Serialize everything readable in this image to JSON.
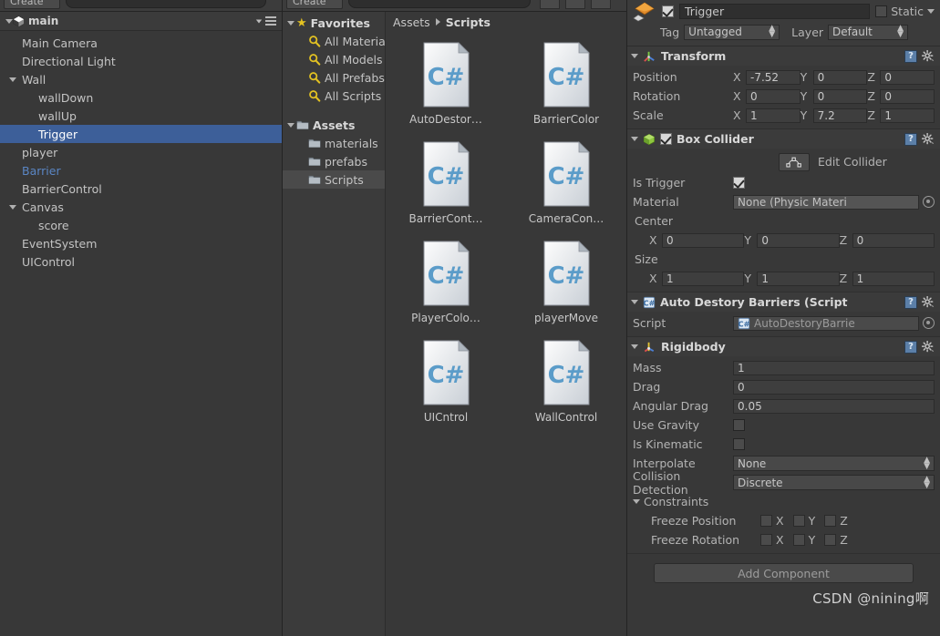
{
  "toolbars": {
    "create_label": "Create",
    "hierarchy_search_placeholder": "",
    "project_search_placeholder": ""
  },
  "hierarchy": {
    "scene_name": "main",
    "scene_icon": "unity-scene-icon",
    "menu_icon": "hamburger-menu-icon",
    "items": [
      {
        "label": "Main Camera",
        "depth": 1,
        "fold": "",
        "state": "normal"
      },
      {
        "label": "Directional Light",
        "depth": 1,
        "fold": "",
        "state": "normal"
      },
      {
        "label": "Wall",
        "depth": 1,
        "fold": "open",
        "state": "normal"
      },
      {
        "label": "wallDown",
        "depth": 2,
        "fold": "",
        "state": "normal"
      },
      {
        "label": "wallUp",
        "depth": 2,
        "fold": "",
        "state": "normal"
      },
      {
        "label": "Trigger",
        "depth": 2,
        "fold": "",
        "state": "selected"
      },
      {
        "label": "player",
        "depth": 1,
        "fold": "",
        "state": "normal"
      },
      {
        "label": "Barrier",
        "depth": 1,
        "fold": "",
        "state": "prefab"
      },
      {
        "label": "BarrierControl",
        "depth": 1,
        "fold": "",
        "state": "normal"
      },
      {
        "label": "Canvas",
        "depth": 1,
        "fold": "open",
        "state": "normal"
      },
      {
        "label": "score",
        "depth": 2,
        "fold": "",
        "state": "normal"
      },
      {
        "label": "EventSystem",
        "depth": 1,
        "fold": "",
        "state": "normal"
      },
      {
        "label": "UIControl",
        "depth": 1,
        "fold": "",
        "state": "normal"
      }
    ]
  },
  "project": {
    "tree": [
      {
        "label": "Favorites",
        "depth": 0,
        "fold": "open",
        "icon": "star-icon",
        "bold": true,
        "selected": false
      },
      {
        "label": "All Materials",
        "depth": 1,
        "fold": "",
        "icon": "search-icon",
        "bold": false,
        "selected": false
      },
      {
        "label": "All Models",
        "depth": 1,
        "fold": "",
        "icon": "search-icon",
        "bold": false,
        "selected": false
      },
      {
        "label": "All Prefabs",
        "depth": 1,
        "fold": "",
        "icon": "search-icon",
        "bold": false,
        "selected": false
      },
      {
        "label": "All Scripts",
        "depth": 1,
        "fold": "",
        "icon": "search-icon",
        "bold": false,
        "selected": false
      },
      {
        "label": "",
        "depth": 0,
        "fold": "",
        "icon": "",
        "bold": false,
        "selected": false
      },
      {
        "label": "Assets",
        "depth": 0,
        "fold": "open",
        "icon": "folder-icon",
        "bold": true,
        "selected": false
      },
      {
        "label": "materials",
        "depth": 1,
        "fold": "",
        "icon": "folder-icon",
        "bold": false,
        "selected": false
      },
      {
        "label": "prefabs",
        "depth": 1,
        "fold": "",
        "icon": "folder-icon",
        "bold": false,
        "selected": false
      },
      {
        "label": "Scripts",
        "depth": 1,
        "fold": "",
        "icon": "folder-icon",
        "bold": false,
        "selected": true
      }
    ],
    "breadcrumb": [
      "Assets",
      "Scripts"
    ],
    "assets": [
      {
        "label": "AutoDestor…",
        "icon": "csharp-script-icon"
      },
      {
        "label": "BarrierColor",
        "icon": "csharp-script-icon"
      },
      {
        "label": "BarrierCont…",
        "icon": "csharp-script-icon"
      },
      {
        "label": "CameraCon…",
        "icon": "csharp-script-icon"
      },
      {
        "label": "PlayerColo…",
        "icon": "csharp-script-icon"
      },
      {
        "label": "playerMove",
        "icon": "csharp-script-icon"
      },
      {
        "label": "UICntrol",
        "icon": "csharp-script-icon"
      },
      {
        "label": "WallControl",
        "icon": "csharp-script-icon"
      }
    ]
  },
  "inspector": {
    "gameobject": {
      "icon": "gameobject-cube-icon",
      "enabled": true,
      "name": "Trigger",
      "static_label": "Static",
      "static_checked": false,
      "tag_label": "Tag",
      "tag_value": "Untagged",
      "layer_label": "Layer",
      "layer_value": "Default"
    },
    "components": [
      {
        "name": "Transform",
        "icon": "transform-icon",
        "expanded": true,
        "has_enable_checkbox": false,
        "rows": [
          {
            "label": "Position",
            "type": "vector3",
            "x": "-7.52",
            "y": "0",
            "z": "0"
          },
          {
            "label": "Rotation",
            "type": "vector3",
            "x": "0",
            "y": "0",
            "z": "0"
          },
          {
            "label": "Scale",
            "type": "vector3",
            "x": "1",
            "y": "7.2",
            "z": "1"
          }
        ]
      },
      {
        "name": "Box Collider",
        "icon": "box-collider-icon",
        "expanded": true,
        "has_enable_checkbox": true,
        "enabled": true,
        "edit_collider_label": "Edit Collider",
        "rows": [
          {
            "label": "Is Trigger",
            "type": "checkbox",
            "value": true
          },
          {
            "label": "Material",
            "type": "object",
            "value": "None (Physic Materi"
          },
          {
            "label": "Center",
            "type": "vector3-stacked",
            "x": "0",
            "y": "0",
            "z": "0"
          },
          {
            "label": "Size",
            "type": "vector3-stacked",
            "x": "1",
            "y": "1",
            "z": "1"
          }
        ]
      },
      {
        "name": "Auto Destory Barriers (Script",
        "icon": "csharp-component-icon",
        "expanded": true,
        "has_enable_checkbox": false,
        "rows": [
          {
            "label": "Script",
            "type": "object-dim",
            "value": "AutoDestoryBarrie"
          }
        ]
      },
      {
        "name": "Rigidbody",
        "icon": "rigidbody-icon",
        "expanded": true,
        "has_enable_checkbox": false,
        "rows": [
          {
            "label": "Mass",
            "type": "text",
            "value": "1"
          },
          {
            "label": "Drag",
            "type": "text",
            "value": "0"
          },
          {
            "label": "Angular Drag",
            "type": "text",
            "value": "0.05"
          },
          {
            "label": "Use Gravity",
            "type": "checkbox",
            "value": false
          },
          {
            "label": "Is Kinematic",
            "type": "checkbox",
            "value": false
          },
          {
            "label": "Interpolate",
            "type": "dropdown",
            "value": "None"
          },
          {
            "label": "Collision Detection",
            "type": "dropdown",
            "value": "Discrete"
          }
        ],
        "constraints": {
          "label": "Constraints",
          "freeze_position_label": "Freeze Position",
          "freeze_rotation_label": "Freeze Rotation",
          "axes": [
            "X",
            "Y",
            "Z"
          ],
          "freeze_position": [
            false,
            false,
            false
          ],
          "freeze_rotation": [
            false,
            false,
            false
          ]
        }
      }
    ],
    "add_component_label": "Add Component"
  },
  "watermark": "CSDN @nining啊",
  "colors": {
    "panel_bg": "#383838",
    "header_bg": "#3b3b3b",
    "selection_blue": "#3d5f99",
    "prefab_blue": "#5a86c4",
    "field_bg": "#3e3e3e",
    "star_yellow": "#e3c222",
    "gameobject_orange": "#e08a2b"
  }
}
